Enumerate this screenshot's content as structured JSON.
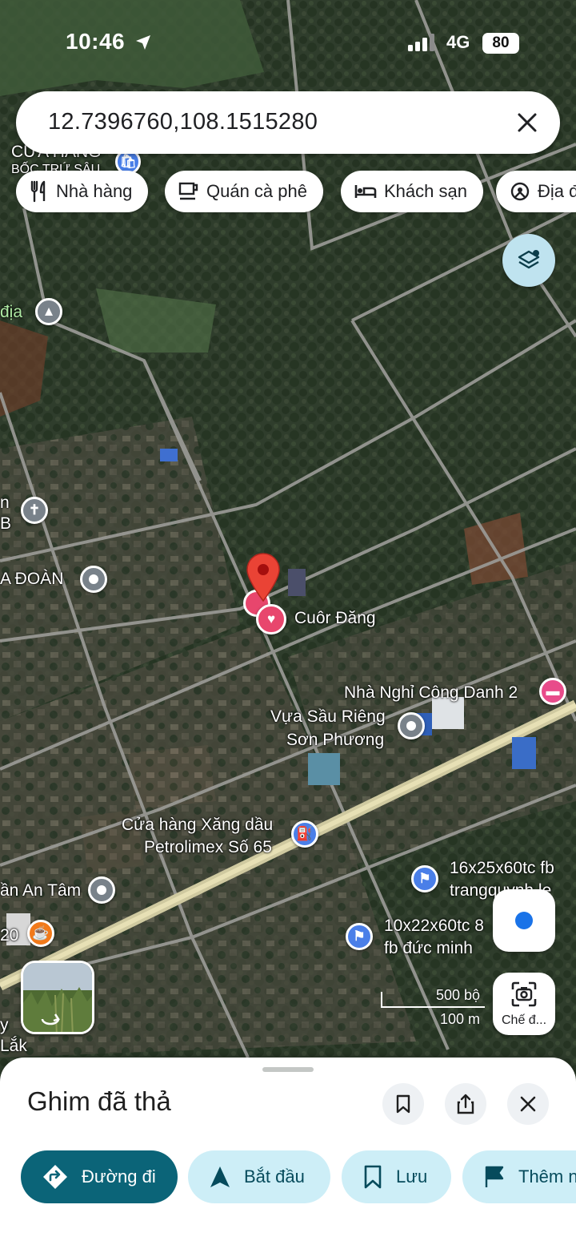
{
  "status_bar": {
    "time": "10:46",
    "network": "4G",
    "battery": "80"
  },
  "search": {
    "query": "12.7396760,108.1515280"
  },
  "chips": [
    {
      "label": "Nhà hàng",
      "icon": "fork-knife-icon"
    },
    {
      "label": "Quán cà phê",
      "icon": "coffee-cup-icon"
    },
    {
      "label": "Khách sạn",
      "icon": "bed-icon"
    },
    {
      "label": "Địa đ",
      "icon": "landmark-icon"
    }
  ],
  "map_labels": {
    "top_left_store": "CỬA HÀNG",
    "top_left_store2": "BỐC TRỨ SẬU",
    "dia": "địa",
    "n": "n",
    "b": "B",
    "a_doan": "A ĐOÀN",
    "cuon_dang": "Cuôr Đăng",
    "nha_nghi": "Nhà Nghỉ Công Danh 2",
    "vua_sau_rieng_1": "Vựa Sầu Riêng",
    "vua_sau_rieng_2": "Sơn Phương",
    "cua_hang_xang_1": "Cửa hàng Xăng dầu",
    "cua_hang_xang_2": "Petrolimex Số 65",
    "lot1_1": "16x25x60tc fb",
    "lot1_2": "trangquynh le",
    "lot2_1": "10x22x60tc 8",
    "lot2_2": "fb đức minh",
    "an_tam": "ần An Tâm",
    "num_20": "20",
    "y": "y",
    "lak": "Lắk"
  },
  "scale": {
    "primary": "500 bộ",
    "secondary": "100 m"
  },
  "lens": {
    "label": "Chế đ..."
  },
  "sheet": {
    "title": "Ghim đã thả",
    "actions": [
      {
        "label": "Đường đi",
        "icon": "directions-icon"
      },
      {
        "label": "Bắt đầu",
        "icon": "navigation-arrow-icon"
      },
      {
        "label": "Lưu",
        "icon": "bookmark-icon"
      },
      {
        "label": "Thêm n",
        "icon": "flag-icon"
      }
    ]
  }
}
